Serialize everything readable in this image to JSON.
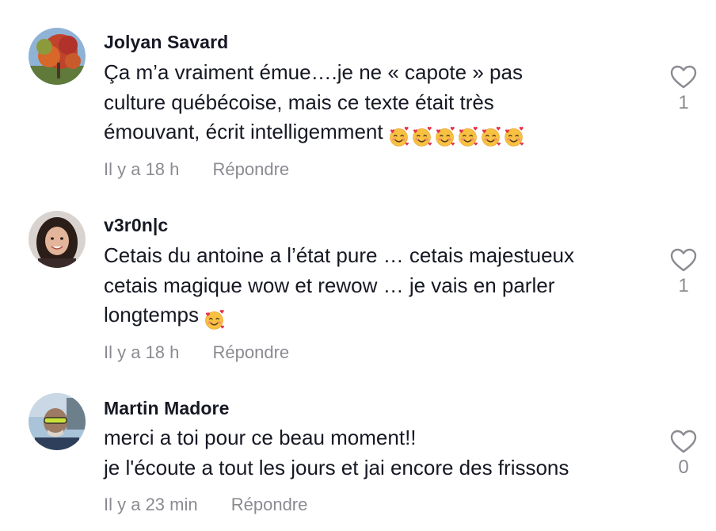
{
  "comments": [
    {
      "username": "Jolyan Savard",
      "lines": [
        "Ça m’a vraiment émue….je ne « capote » pas",
        "culture québécoise, mais ce texte était très",
        "émouvant, écrit intelligemment"
      ],
      "emoji_count": 6,
      "emoji": "smiling-face-with-hearts",
      "time": "Il y a 18 h",
      "reply_label": "Répondre",
      "likes": "1"
    },
    {
      "username": "v3r0n|c",
      "lines": [
        "Cetais du antoine a l’état pure … cetais majestueux",
        "cetais magique wow et rewow … je vais en parler",
        "longtemps"
      ],
      "emoji_count": 1,
      "emoji": "smiling-face-with-hearts",
      "time": "Il y a 18 h",
      "reply_label": "Répondre",
      "likes": "1"
    },
    {
      "username": "Martin Madore",
      "lines": [
        "merci a toi pour ce beau moment!!",
        "je l'écoute a tout les jours et jai encore des frissons"
      ],
      "emoji_count": 0,
      "time": "Il y a 23 min",
      "reply_label": "Répondre",
      "likes": "0"
    }
  ],
  "icons": {
    "like": "heart-outline-icon",
    "emoji": "smiling-face-with-hearts-emoji"
  },
  "colors": {
    "text": "#161823",
    "muted": "#8a8b91",
    "heart_stroke": "#8a8b91"
  }
}
